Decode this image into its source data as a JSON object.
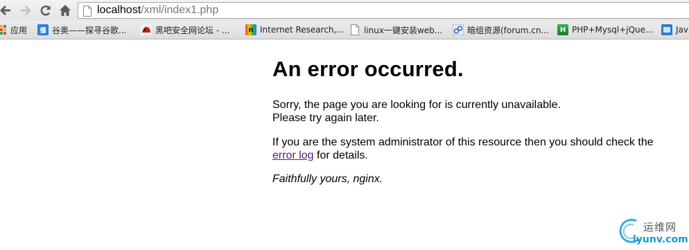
{
  "toolbar": {
    "back_icon": "back-arrow-icon",
    "forward_icon": "forward-arrow-icon",
    "reload_icon": "reload-icon",
    "home_icon": "home-icon",
    "url_host": "localhost",
    "url_path": "/xml/index1.php"
  },
  "bookmarks": [
    {
      "label": "应用",
      "icon": "apps-grid-icon"
    },
    {
      "label": "谷奥——探寻谷歌...",
      "icon": "guao-icon",
      "icon_color": "#2d7fd6",
      "glyph": "播"
    },
    {
      "label": "黑吧安全网论坛 - ...",
      "icon": "heiba-icon",
      "icon_color": "#c0201c"
    },
    {
      "label": "Internet Research,...",
      "icon": "internet-research-icon",
      "icon_color": "#e8a400",
      "glyph": "n"
    },
    {
      "label": "linux一键安装web...",
      "icon": "page-icon"
    },
    {
      "label": "暗组资源(forum.cn...",
      "icon": "anzu-icon"
    },
    {
      "label": "PHP+Mysql+jQue...",
      "icon": "php-icon",
      "icon_color": "#2b9c3a",
      "glyph": "H"
    },
    {
      "label": "Jav",
      "icon": "java-icon",
      "icon_color": "#2c7ec4"
    }
  ],
  "page": {
    "heading": "An error occurred.",
    "para1_line1": "Sorry, the page you are looking for is currently unavailable.",
    "para1_line2": "Please try again later.",
    "para2_before": "If you are the system administrator of this resource then you should check the ",
    "para2_link": "error log",
    "para2_after": " for details.",
    "signature": "Faithfully yours, nginx."
  },
  "watermark": {
    "cn": "运维网",
    "en": "iyunv.com"
  }
}
